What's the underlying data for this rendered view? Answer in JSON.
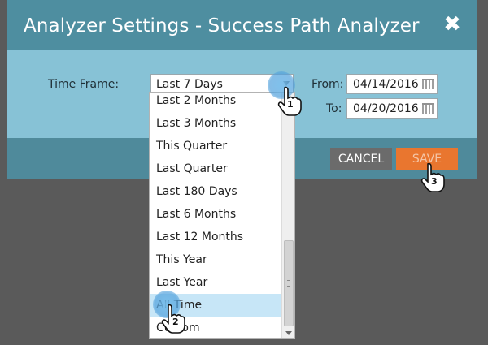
{
  "dialog": {
    "title": "Analyzer Settings - Success Path Analyzer",
    "close_glyph": "✖"
  },
  "form": {
    "time_frame_label": "Time Frame:",
    "time_frame_value": "Last 7 Days",
    "from_label": "From:",
    "from_value": "04/14/2016",
    "to_label": "To:",
    "to_value": "04/20/2016"
  },
  "dropdown": {
    "options": [
      "Last 2 Months",
      "Last 3 Months",
      "This Quarter",
      "Last Quarter",
      "Last 180 Days",
      "Last 6 Months",
      "Last 12 Months",
      "This Year",
      "Last Year",
      "All Time",
      "Custom"
    ],
    "highlighted": "All Time"
  },
  "footer": {
    "cancel_label": "CANCEL",
    "save_label": "SAVE"
  },
  "steps": {
    "one": "1",
    "two": "2",
    "three": "3"
  },
  "colors": {
    "header": "#4e8ea0",
    "body": "#87c2d6",
    "footer": "#4f8a9b",
    "save": "#e9762f",
    "cancel": "#6b6b6b",
    "highlight": "#c7e6f7",
    "backdrop": "#5a5a5a"
  }
}
